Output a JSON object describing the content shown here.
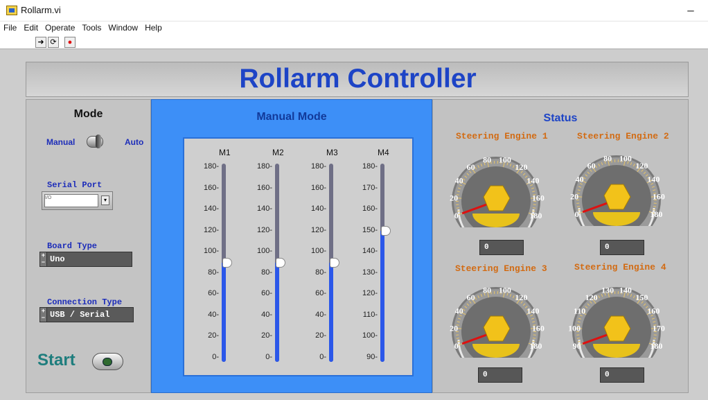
{
  "window": {
    "title": "Rollarm.vi",
    "minimize": "–"
  },
  "menu": [
    "File",
    "Edit",
    "Operate",
    "Tools",
    "Window",
    "Help"
  ],
  "toolbar": {
    "run": "➜",
    "run_cont": "⟳",
    "abort": "●"
  },
  "header": {
    "title": "Rollarm Controller"
  },
  "mode": {
    "title": "Mode",
    "manual": "Manual",
    "auto": "Auto",
    "serial_port_label": "Serial Port",
    "serial_port_value": "",
    "board_type_label": "Board Type",
    "board_type_value": "Uno",
    "connection_type_label": "Connection Type",
    "connection_type_value": "USB / Serial",
    "start": "Start"
  },
  "manual": {
    "title": "Manual Mode",
    "sliders": [
      {
        "name": "M1",
        "ticks": [
          "180",
          "160",
          "140",
          "120",
          "100",
          "80",
          "60",
          "40",
          "20",
          "0"
        ],
        "value": 90,
        "min": 0,
        "max": 180
      },
      {
        "name": "M2",
        "ticks": [
          "180",
          "160",
          "140",
          "120",
          "100",
          "80",
          "60",
          "40",
          "20",
          "0"
        ],
        "value": 90,
        "min": 0,
        "max": 180
      },
      {
        "name": "M3",
        "ticks": [
          "180",
          "160",
          "140",
          "120",
          "100",
          "80",
          "60",
          "40",
          "20",
          "0"
        ],
        "value": 90,
        "min": 0,
        "max": 180
      },
      {
        "name": "M4",
        "ticks": [
          "180",
          "170",
          "160",
          "150",
          "140",
          "130",
          "120",
          "110",
          "100",
          "90"
        ],
        "value": 150,
        "min": 90,
        "max": 180
      }
    ]
  },
  "status": {
    "title": "Status",
    "engines": [
      {
        "name": "Steering Engine 1",
        "ticks": [
          "0",
          "20",
          "40",
          "60",
          "80",
          "100",
          "120",
          "140",
          "160",
          "180"
        ],
        "value": "0"
      },
      {
        "name": "Steering Engine 2",
        "ticks": [
          "0",
          "20",
          "40",
          "60",
          "80",
          "100",
          "120",
          "140",
          "160",
          "180"
        ],
        "value": "0"
      },
      {
        "name": "Steering Engine 3",
        "ticks": [
          "0",
          "20",
          "40",
          "60",
          "80",
          "100",
          "120",
          "140",
          "160",
          "180"
        ],
        "value": "0"
      },
      {
        "name": "Steering Engine 4",
        "ticks": [
          "90",
          "100",
          "110",
          "120",
          "130",
          "140",
          "150",
          "160",
          "170",
          "180"
        ],
        "value": "0"
      }
    ]
  },
  "colors": {
    "accent": "#1d44c6",
    "panel_blue": "#3d8ff7",
    "engine_label": "#d26b13",
    "fill": "#2b57e9",
    "knob": "#f2c21a"
  }
}
